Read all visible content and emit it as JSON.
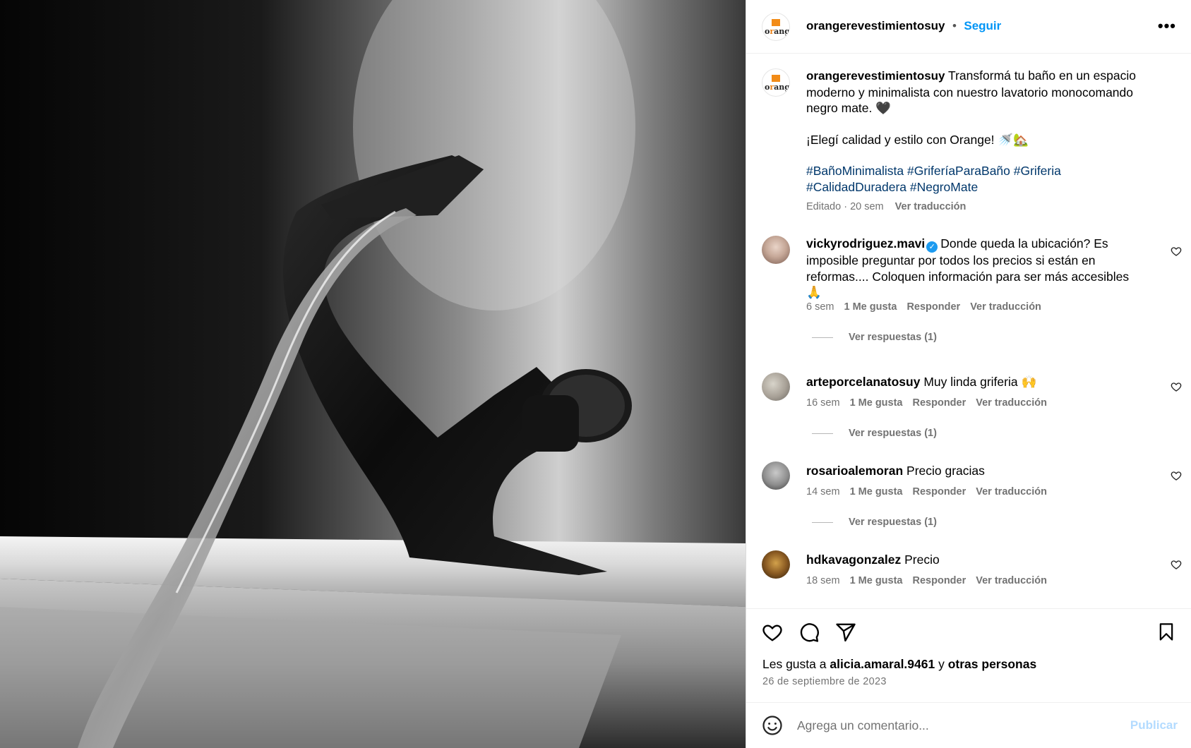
{
  "post": {
    "username": "orangerevestimientosuy",
    "follow_label": "Seguir",
    "dot": "•",
    "more_label": "•••",
    "logo_text": "orange"
  },
  "caption": {
    "username": "orangerevestimientosuy",
    "text": " Transformá tu baño en un espacio moderno y minimalista con nuestro lavatorio monocomando negro mate. 🖤",
    "line2": "¡Elegí calidad y estilo con Orange! 🚿🏡",
    "hashtags": "#BañoMinimalista #GriferíaParaBaño #Griferia #CalidadDuradera #NegroMate",
    "edited": "Editado · 20 sem",
    "translate": "Ver traducción"
  },
  "comments": [
    {
      "username": "vickyrodriguez.mavi",
      "verified": true,
      "text": "Donde queda la ubicación? Es imposible preguntar por todos los precios si están en reformas.... Coloquen información para ser más accesibles 🙏",
      "time": "6 sem",
      "likes": "1 Me gusta",
      "reply": "Responder",
      "translate": "Ver traducción",
      "replies": "Ver respuestas (1)"
    },
    {
      "username": "arteporcelanatosuy",
      "verified": false,
      "text": "Muy linda griferia 🙌",
      "time": "16 sem",
      "likes": "1 Me gusta",
      "reply": "Responder",
      "translate": "Ver traducción",
      "replies": "Ver respuestas (1)"
    },
    {
      "username": "rosarioalemoran",
      "verified": false,
      "text": "Precio gracias",
      "time": "14 sem",
      "likes": "1 Me gusta",
      "reply": "Responder",
      "translate": "Ver traducción",
      "replies": "Ver respuestas (1)"
    },
    {
      "username": "hdkavagonzalez",
      "verified": false,
      "text": "Precio",
      "time": "18 sem",
      "likes": "1 Me gusta",
      "reply": "Responder",
      "translate": "Ver traducción",
      "replies": ""
    }
  ],
  "likes_line": {
    "prefix": "Les gusta a ",
    "user": "alicia.amaral.9461",
    "middle": " y ",
    "others": "otras personas"
  },
  "date": "26 de septiembre de 2023",
  "add_comment": {
    "placeholder": "Agrega un comentario...",
    "publish": "Publicar"
  },
  "icons": {
    "like": "heart-icon",
    "comment": "comment-icon",
    "share": "share-icon",
    "save": "bookmark-icon",
    "emoji": "emoji-icon",
    "brand": "#f28b17",
    "link": "#0095f6"
  }
}
